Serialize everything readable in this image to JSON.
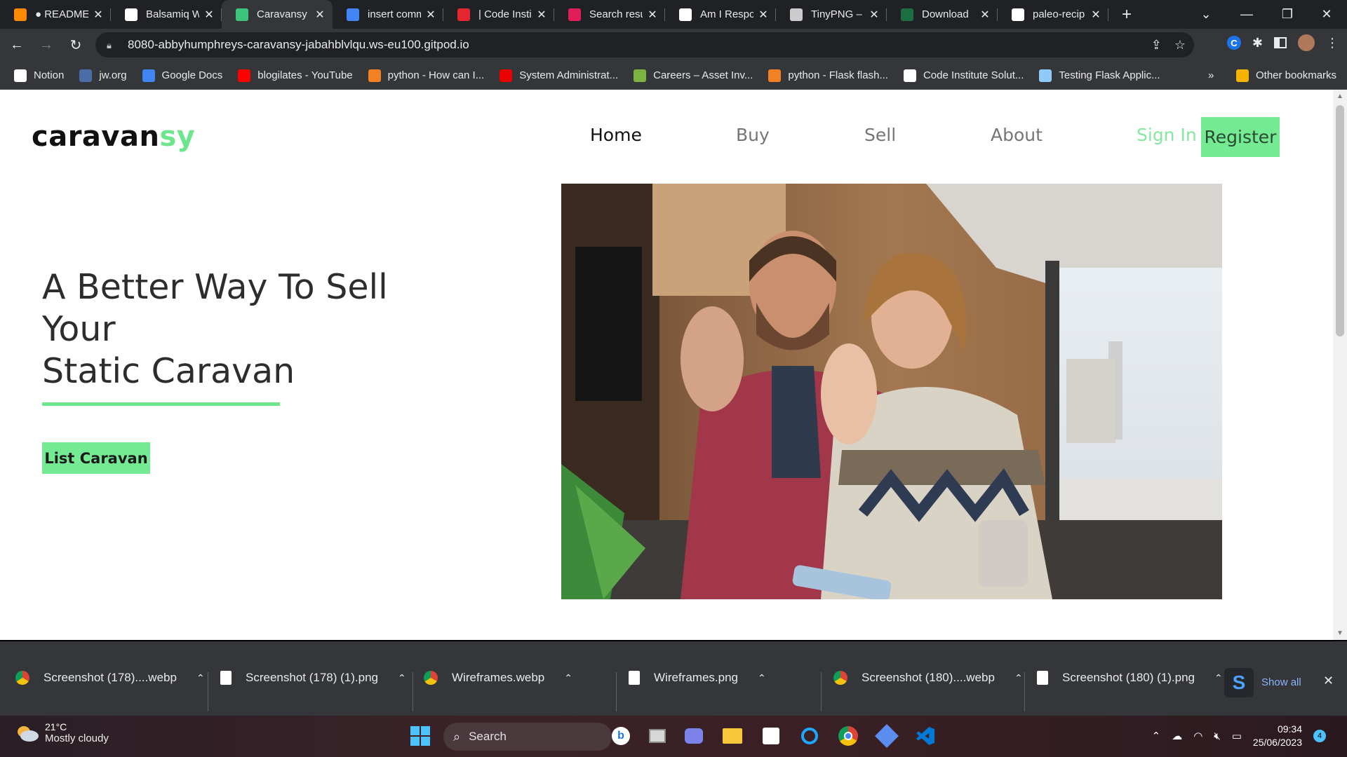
{
  "browser": {
    "tabs": [
      {
        "title": "● README.md",
        "favicon": "gitpod-icon",
        "color": "#ff8a00"
      },
      {
        "title": "Balsamiq W",
        "favicon": "balsamiq-icon",
        "color": "#ffffff"
      },
      {
        "title": "Caravansy",
        "favicon": "caravansy-icon",
        "color": "#3cc47c",
        "active": true
      },
      {
        "title": "insert comm",
        "favicon": "google-icon",
        "color": "#4285f4"
      },
      {
        "title": "| Code Insti",
        "favicon": "opera-icon",
        "color": "#e3262f"
      },
      {
        "title": "Search resu",
        "favicon": "slack-icon",
        "color": "#e01e5a"
      },
      {
        "title": "Am I Respo",
        "favicon": "text-t-icon",
        "color": "#ffffff"
      },
      {
        "title": "TinyPNG – (",
        "favicon": "tinypng-icon",
        "color": "#cccccc"
      },
      {
        "title": "Download",
        "favicon": "excel-icon",
        "color": "#1d6f42"
      },
      {
        "title": "paleo-recip",
        "favicon": "github-icon",
        "color": "#ffffff"
      }
    ],
    "url": "8080-abbyhumphreys-caravansy-jabahblvlqu.ws-eu100.gitpod.io",
    "bookmarks": [
      {
        "label": "Notion",
        "icon": "notion-icon",
        "color": "#ffffff"
      },
      {
        "label": "jw.org",
        "icon": "jw-icon",
        "color": "#4a6da7"
      },
      {
        "label": "Google Docs",
        "icon": "docs-icon",
        "color": "#4285f4"
      },
      {
        "label": "blogilates - YouTube",
        "icon": "youtube-icon",
        "color": "#ff0000"
      },
      {
        "label": "python - How can I...",
        "icon": "stackoverflow-icon",
        "color": "#f48024"
      },
      {
        "label": "System Administrat...",
        "icon": "redhat-icon",
        "color": "#ee0000"
      },
      {
        "label": "Careers – Asset Inv...",
        "icon": "leaf-icon",
        "color": "#7cb342"
      },
      {
        "label": "python - Flask flash...",
        "icon": "stackoverflow-icon",
        "color": "#f48024"
      },
      {
        "label": "Code Institute Solut...",
        "icon": "github-icon",
        "color": "#ffffff"
      },
      {
        "label": "Testing Flask Applic...",
        "icon": "cube-icon",
        "color": "#90caf9"
      }
    ],
    "bookmarks_overflow": "»",
    "other_bookmarks": "Other bookmarks"
  },
  "site": {
    "logo_main": "caravan",
    "logo_accent": "sy",
    "accent_color": "#6ee68d",
    "nav": [
      "Home",
      "Buy",
      "Sell",
      "About"
    ],
    "sign_in": "Sign In",
    "register": "Register",
    "hero_line1": "A Better Way To Sell",
    "hero_line2": "Your",
    "hero_line3": "Static Caravan",
    "cta": "List Caravan"
  },
  "downloads": {
    "items": [
      {
        "name": "Screenshot (178)....webp",
        "icon": "chrome-icon"
      },
      {
        "name": "Screenshot (178) (1).png",
        "icon": "image-file-icon"
      },
      {
        "name": "Wireframes.webp",
        "icon": "chrome-icon"
      },
      {
        "name": "Wireframes.png",
        "icon": "image-file-icon"
      },
      {
        "name": "Screenshot (180)....webp",
        "icon": "chrome-icon"
      },
      {
        "name": "Screenshot (180) (1).png",
        "icon": "image-file-icon"
      }
    ],
    "show_all": "Show all"
  },
  "taskbar": {
    "temperature": "21°C",
    "weather": "Mostly cloudy",
    "search": "Search",
    "time": "09:34",
    "date": "25/06/2023",
    "notifications": "4"
  }
}
